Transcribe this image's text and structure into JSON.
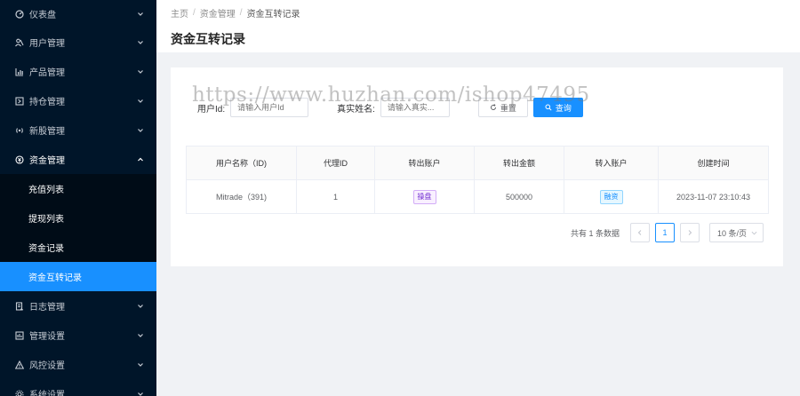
{
  "sidebar": {
    "items": [
      {
        "label": "仪表盘",
        "icon": "dashboard-icon"
      },
      {
        "label": "用户管理",
        "icon": "users-icon"
      },
      {
        "label": "产品管理",
        "icon": "chart-icon"
      },
      {
        "label": "持仓管理",
        "icon": "position-icon"
      },
      {
        "label": "新股管理",
        "icon": "signal-icon"
      },
      {
        "label": "资金管理",
        "icon": "money-icon"
      }
    ],
    "submenu": [
      {
        "label": "充值列表"
      },
      {
        "label": "提现列表"
      },
      {
        "label": "资金记录"
      },
      {
        "label": "资金互转记录"
      }
    ],
    "after": [
      {
        "label": "日志管理",
        "icon": "log-icon"
      },
      {
        "label": "管理设置",
        "icon": "settings-icon"
      },
      {
        "label": "风控设置",
        "icon": "warning-icon"
      },
      {
        "label": "系统设置",
        "icon": "system-icon"
      }
    ]
  },
  "breadcrumb": {
    "home": "主页",
    "parent": "资金管理",
    "current": "资金互转记录"
  },
  "page": {
    "title": "资金互转记录"
  },
  "watermark": "https://www.huzhan.com/ishop47495",
  "filters": {
    "user_id_label": "用户Id:",
    "user_id_placeholder": "请输入用户Id",
    "real_name_label": "真实姓名:",
    "real_name_placeholder": "请输入真实...",
    "reset": "重置",
    "search": "查询"
  },
  "table": {
    "columns": [
      "用户名称（ID)",
      "代理ID",
      "转出账户",
      "转出金额",
      "转入账户",
      "创建时间"
    ],
    "rows": [
      {
        "user": "Mitrade（391)",
        "agent_id": "1",
        "from_account": "操盘",
        "amount": "500000",
        "to_account": "融资",
        "created": "2023-11-07 23:10:43"
      }
    ]
  },
  "pagination": {
    "total": "共有 1 条数据",
    "current": "1",
    "page_size": "10 条/页"
  },
  "colors": {
    "sidebar_bg": "#001529",
    "active": "#1890ff"
  }
}
